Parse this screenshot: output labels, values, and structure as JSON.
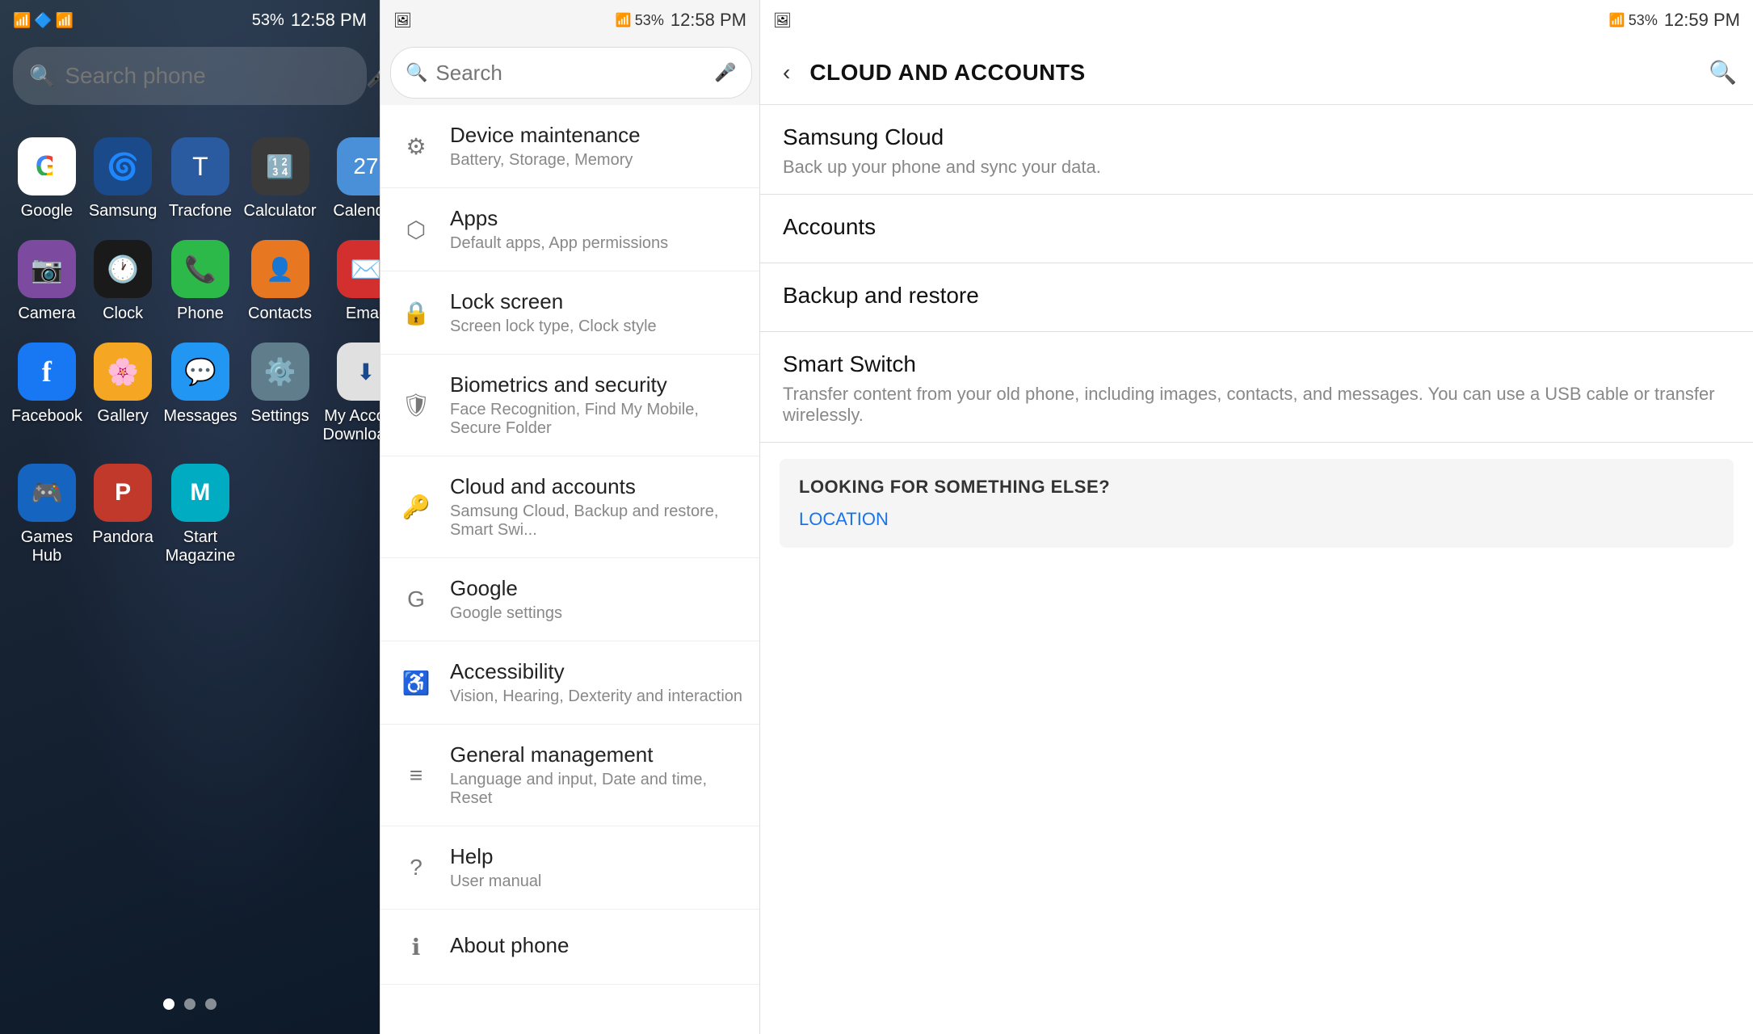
{
  "panel1": {
    "statusBar": {
      "time": "12:58 PM",
      "battery": "53%"
    },
    "searchBar": {
      "placeholder": "Search phone"
    },
    "apps": [
      {
        "id": "google",
        "label": "Google",
        "iconClass": "icon-google",
        "emoji": "G"
      },
      {
        "id": "samsung",
        "label": "Samsung",
        "iconClass": "icon-samsung",
        "emoji": "🌀"
      },
      {
        "id": "tracfone",
        "label": "Tracfone",
        "iconClass": "icon-tracfone",
        "emoji": "T"
      },
      {
        "id": "calculator",
        "label": "Calculator",
        "iconClass": "icon-calculator",
        "emoji": "🔢"
      },
      {
        "id": "calendar",
        "label": "Calendar",
        "iconClass": "icon-calendar",
        "emoji": "📅"
      },
      {
        "id": "camera",
        "label": "Camera",
        "iconClass": "icon-camera",
        "emoji": "📷"
      },
      {
        "id": "clock",
        "label": "Clock",
        "iconClass": "icon-clock",
        "emoji": "🕐"
      },
      {
        "id": "phone",
        "label": "Phone",
        "iconClass": "icon-phone",
        "emoji": "📞"
      },
      {
        "id": "contacts",
        "label": "Contacts",
        "iconClass": "icon-contacts",
        "emoji": "👤"
      },
      {
        "id": "email",
        "label": "Email",
        "iconClass": "icon-email",
        "emoji": "✉️"
      },
      {
        "id": "facebook",
        "label": "Facebook",
        "iconClass": "icon-facebook",
        "emoji": "f"
      },
      {
        "id": "gallery",
        "label": "Gallery",
        "iconClass": "icon-gallery",
        "emoji": "🌸"
      },
      {
        "id": "messages",
        "label": "Messages",
        "iconClass": "icon-messages",
        "emoji": "💬"
      },
      {
        "id": "settings",
        "label": "Settings",
        "iconClass": "icon-settings",
        "emoji": "⚙️"
      },
      {
        "id": "myaccount",
        "label": "My Account\nDownloader",
        "iconClass": "icon-myaccount",
        "emoji": "⬇️"
      },
      {
        "id": "gameshub",
        "label": "Games Hub",
        "iconClass": "icon-gameshub",
        "emoji": "🎮"
      },
      {
        "id": "pandora",
        "label": "Pandora",
        "iconClass": "icon-pandora",
        "emoji": "P"
      },
      {
        "id": "startmag",
        "label": "Start\nMagazine",
        "iconClass": "icon-startmag",
        "emoji": "M"
      }
    ],
    "dots": [
      {
        "active": true
      },
      {
        "active": false
      },
      {
        "active": false
      }
    ]
  },
  "panel2": {
    "statusBar": {
      "time": "12:58 PM",
      "battery": "53%"
    },
    "searchBar": {
      "placeholder": "Search"
    },
    "settingsItems": [
      {
        "id": "device-maintenance",
        "icon": "⚙",
        "title": "Device maintenance",
        "subtitle": "Battery, Storage, Memory"
      },
      {
        "id": "apps",
        "icon": "⬡",
        "title": "Apps",
        "subtitle": "Default apps, App permissions"
      },
      {
        "id": "lock-screen",
        "icon": "🔒",
        "title": "Lock screen",
        "subtitle": "Screen lock type, Clock style"
      },
      {
        "id": "biometrics",
        "icon": "🛡",
        "title": "Biometrics and security",
        "subtitle": "Face Recognition, Find My Mobile, Secure Folder"
      },
      {
        "id": "cloud-accounts",
        "icon": "🔑",
        "title": "Cloud and accounts",
        "subtitle": "Samsung Cloud, Backup and restore, Smart Swi..."
      },
      {
        "id": "google",
        "icon": "G",
        "title": "Google",
        "subtitle": "Google settings"
      },
      {
        "id": "accessibility",
        "icon": "♿",
        "title": "Accessibility",
        "subtitle": "Vision, Hearing, Dexterity and interaction"
      },
      {
        "id": "general-management",
        "icon": "≡",
        "title": "General management",
        "subtitle": "Language and input, Date and time, Reset"
      },
      {
        "id": "help",
        "icon": "?",
        "title": "Help",
        "subtitle": "User manual"
      },
      {
        "id": "about-phone",
        "icon": "ℹ",
        "title": "About phone",
        "subtitle": ""
      }
    ]
  },
  "panel3": {
    "statusBar": {
      "time": "12:59 PM",
      "battery": "53%"
    },
    "header": {
      "title": "CLOUD AND ACCOUNTS",
      "backLabel": "‹",
      "searchLabel": "🔍"
    },
    "sections": [
      {
        "id": "samsung-cloud",
        "title": "Samsung Cloud",
        "subtitle": "Back up your phone and sync your data."
      },
      {
        "id": "accounts",
        "title": "Accounts",
        "subtitle": ""
      },
      {
        "id": "backup-restore",
        "title": "Backup and restore",
        "subtitle": ""
      },
      {
        "id": "smart-switch",
        "title": "Smart Switch",
        "subtitle": "Transfer content from your old phone, including images, contacts, and messages. You can use a USB cable or transfer wirelessly."
      }
    ],
    "lookingBox": {
      "title": "LOOKING FOR SOMETHING ELSE?",
      "link": "LOCATION"
    }
  }
}
